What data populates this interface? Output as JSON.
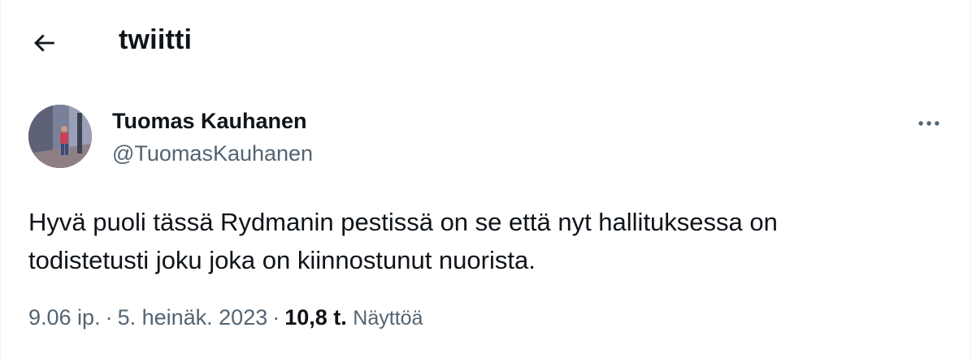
{
  "header": {
    "title": "twiitti"
  },
  "tweet": {
    "author_name": "Tuomas Kauhanen",
    "author_handle": "@TuomasKauhanen",
    "text_line1": "Hyvä puoli tässä Rydmanin pestissä on se että nyt hallituksessa on",
    "text_line2": "todistetusti joku joka on kiinnostunut nuorista.",
    "time": "9.06 ip.",
    "separator": "·",
    "date": "5. heinäk. 2023",
    "views_count": "10,8 t.",
    "views_label": "Näyttöä"
  },
  "icons": {
    "back": "arrow-left-icon",
    "more": "more-horizontal-icon"
  }
}
